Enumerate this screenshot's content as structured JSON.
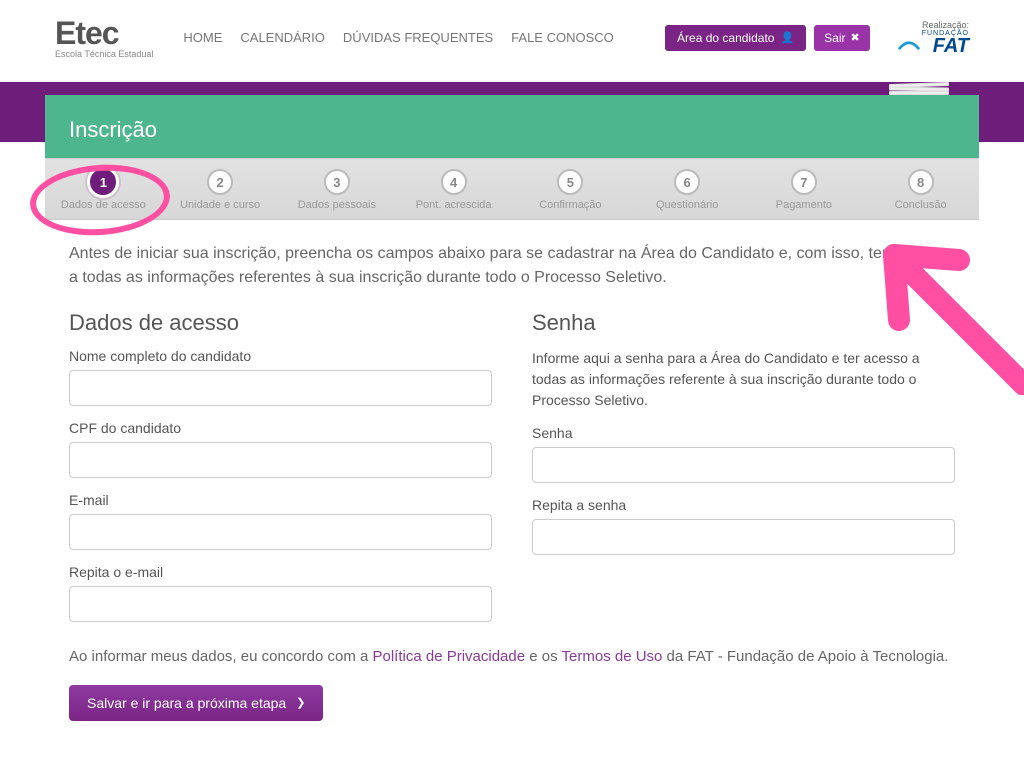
{
  "header": {
    "logo_main": "Etec",
    "logo_sub": "Escola Técnica Estadual",
    "nav": [
      "HOME",
      "CALENDÁRIO",
      "DÚVIDAS FREQUENTES",
      "FALE CONOSCO"
    ],
    "area_btn": "Área do candidato",
    "sair_btn": "Sair",
    "realizacao_label": "Realização:",
    "fat_top": "FUNDAÇÃO",
    "fat_main": "FAT"
  },
  "card": {
    "title": "Inscrição",
    "steps": [
      {
        "num": "1",
        "label": "Dados de acesso",
        "active": true
      },
      {
        "num": "2",
        "label": "Unidade e curso",
        "active": false
      },
      {
        "num": "3",
        "label": "Dados pessoais",
        "active": false
      },
      {
        "num": "4",
        "label": "Pont. acrescida",
        "active": false
      },
      {
        "num": "5",
        "label": "Confirmação",
        "active": false
      },
      {
        "num": "6",
        "label": "Questionário",
        "active": false
      },
      {
        "num": "7",
        "label": "Pagamento",
        "active": false
      },
      {
        "num": "8",
        "label": "Conclusão",
        "active": false
      }
    ]
  },
  "intro": "Antes de iniciar sua inscrição, preencha os campos abaixo para se cadastrar na Área do Candidato e, com isso, ter acesso a todas as informações referentes à sua inscrição durante todo o Processo Seletivo.",
  "left": {
    "title": "Dados de acesso",
    "nome_label": "Nome completo do candidato",
    "cpf_label": "CPF do candidato",
    "email_label": "E-mail",
    "email2_label": "Repita o e-mail"
  },
  "right": {
    "title": "Senha",
    "desc": "Informe aqui a senha para a Área do Candidato e ter acesso a todas as informações referente à sua inscrição durante todo o Processo Seletivo.",
    "senha_label": "Senha",
    "senha2_label": "Repita a senha"
  },
  "consent": {
    "pre": "Ao informar meus dados, eu concordo com a ",
    "link1": "Política de Privacidade",
    "mid": " e os ",
    "link2": "Termos de Uso",
    "post": " da FAT - Fundação de Apoio à Tecnologia."
  },
  "next_btn": "Salvar e ir para a próxima etapa"
}
